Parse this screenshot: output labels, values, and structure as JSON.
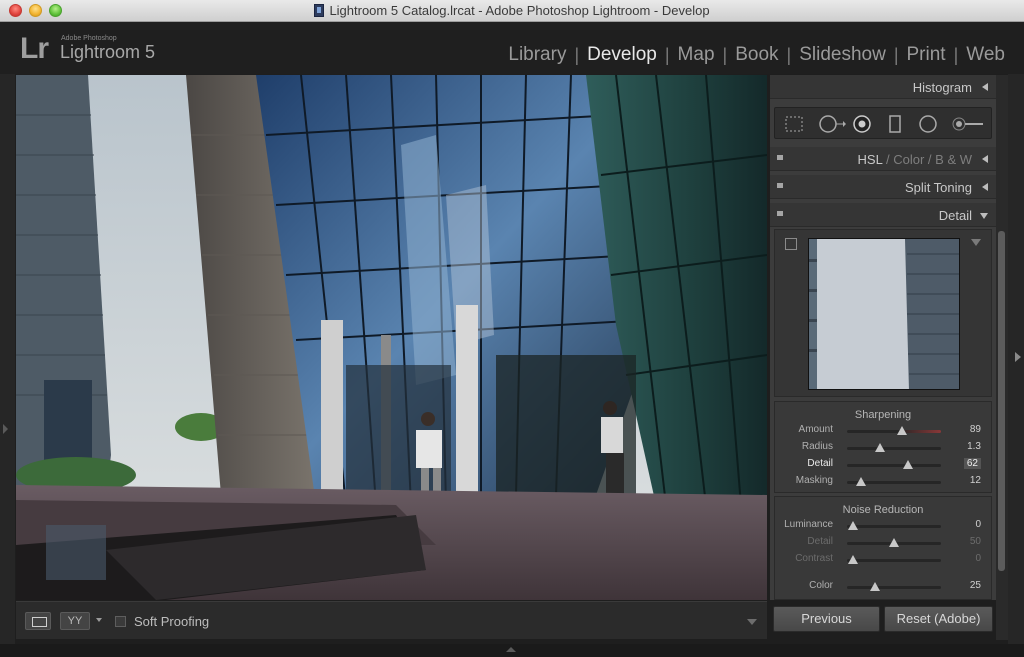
{
  "window": {
    "title": "Lightroom 5 Catalog.lrcat - Adobe Photoshop Lightroom - Develop"
  },
  "app": {
    "logo": "Lr",
    "brand_small": "Adobe Photoshop",
    "brand_name": "Lightroom 5",
    "modules": [
      "Library",
      "Develop",
      "Map",
      "Book",
      "Slideshow",
      "Print",
      "Web"
    ],
    "active_module": "Develop"
  },
  "toolbar": {
    "view_compare_label": "YY",
    "soft_proofing_label": "Soft Proofing",
    "soft_proofing_checked": false
  },
  "right_panel": {
    "histogram_label": "Histogram",
    "hsl": {
      "hsl": "HSL",
      "sep1": "/",
      "color": "Color",
      "sep2": "/",
      "bw": "B & W"
    },
    "split_toning_label": "Split Toning",
    "detail_label": "Detail",
    "sharpening": {
      "title": "Sharpening",
      "sliders": [
        {
          "label": "Amount",
          "value": "89",
          "pos": 0.59
        },
        {
          "label": "Radius",
          "value": "1.3",
          "pos": 0.35
        },
        {
          "label": "Detail",
          "value": "62",
          "pos": 0.65
        },
        {
          "label": "Masking",
          "value": "12",
          "pos": 0.15
        }
      ]
    },
    "noise_reduction": {
      "title": "Noise Reduction",
      "sliders": [
        {
          "label": "Luminance",
          "value": "0",
          "pos": 0.06
        },
        {
          "label": "Detail",
          "value": "50",
          "pos": 0.5
        },
        {
          "label": "Contrast",
          "value": "0",
          "pos": 0.06
        },
        {
          "label": "Color",
          "value": "25",
          "pos": 0.3
        }
      ]
    },
    "previous_label": "Previous",
    "reset_label": "Reset (Adobe)"
  },
  "colors": {
    "accent_active": "#e8e8e8",
    "panel_bg": "#3c3c3c",
    "app_bg": "#1f1f1f"
  }
}
